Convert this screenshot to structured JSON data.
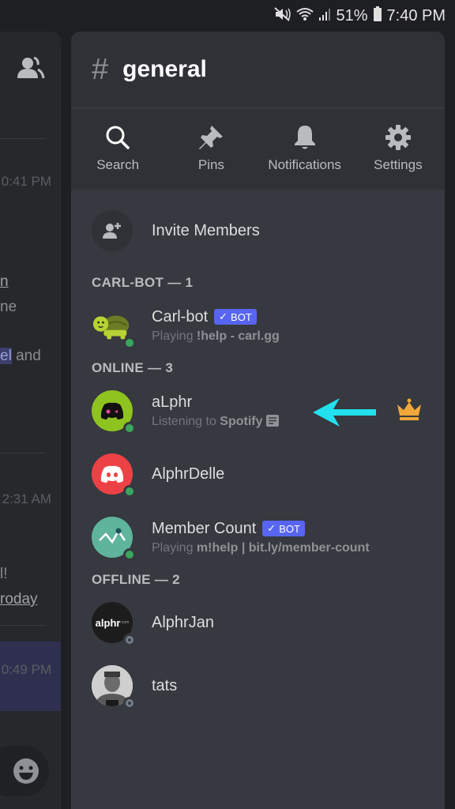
{
  "status_bar": {
    "battery_percent": "51%",
    "time": "7:40 PM",
    "icons": [
      "mute-icon",
      "wifi-icon",
      "signal-icon",
      "battery-icon"
    ]
  },
  "background_chat": {
    "timestamps": [
      "0:41 PM",
      "2:31 AM",
      "0:49 PM"
    ],
    "fragments": [
      "n",
      "ne",
      "el and",
      "l!",
      "roday"
    ]
  },
  "channel": {
    "hash_symbol": "#",
    "name": "general"
  },
  "toolbar": [
    {
      "label": "Search",
      "icon": "search-icon"
    },
    {
      "label": "Pins",
      "icon": "pin-icon"
    },
    {
      "label": "Notifications",
      "icon": "bell-icon"
    },
    {
      "label": "Settings",
      "icon": "gear-icon"
    }
  ],
  "invite": {
    "label": "Invite Members"
  },
  "sections": [
    {
      "header": "CARL-BOT — 1",
      "members": [
        {
          "name": "Carl-bot",
          "bot": true,
          "badge": "BOT",
          "activity_prefix": "Playing ",
          "activity_value": "!help - carl.gg",
          "status": "online"
        }
      ]
    },
    {
      "header": "ONLINE — 3",
      "members": [
        {
          "name": "aLphr",
          "bot": false,
          "activity_prefix": "Listening to ",
          "activity_value": "Spotify",
          "status": "online",
          "owner": true
        },
        {
          "name": "AlphrDelle",
          "bot": false,
          "status": "online"
        },
        {
          "name": "Member Count",
          "bot": true,
          "badge": "BOT",
          "activity_prefix": "Playing ",
          "activity_value": "m!help | bit.ly/member-count",
          "status": "online"
        }
      ]
    },
    {
      "header": "OFFLINE — 2",
      "members": [
        {
          "name": "AlphrJan",
          "bot": false,
          "status": "offline",
          "avatar_text": "alphr"
        },
        {
          "name": "tats",
          "bot": false,
          "status": "offline"
        }
      ]
    }
  ],
  "colors": {
    "accent": "#5865f2",
    "online": "#3ba55d",
    "crown": "#f0a83a",
    "annotation_arrow": "#22e0ee"
  }
}
